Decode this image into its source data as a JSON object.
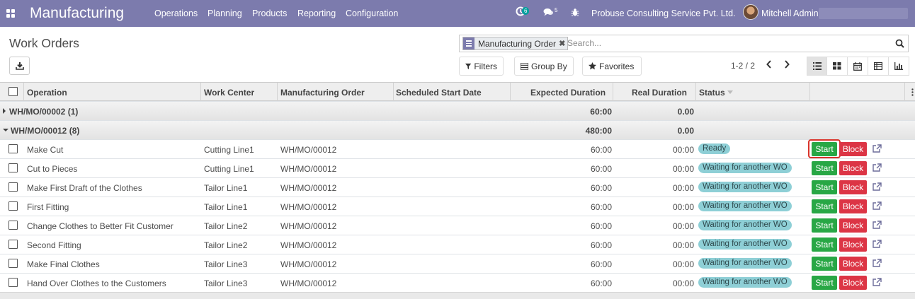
{
  "navbar": {
    "app_name": "Manufacturing",
    "menu": [
      "Operations",
      "Planning",
      "Products",
      "Reporting",
      "Configuration"
    ],
    "activity_count": "6",
    "message_count": "5",
    "company": "Probuse Consulting Service Pvt. Ltd.",
    "user": "Mitchell Admin"
  },
  "control_panel": {
    "title": "Work Orders",
    "facet_value": "Manufacturing Order",
    "search_placeholder": "Search...",
    "filters_label": "Filters",
    "group_by_label": "Group By",
    "favorites_label": "Favorites",
    "pager": "1-2 / 2"
  },
  "table": {
    "headers": {
      "operation": "Operation",
      "work_center": "Work Center",
      "manufacturing_order": "Manufacturing Order",
      "scheduled_start": "Scheduled Start Date",
      "expected_duration": "Expected Duration",
      "real_duration": "Real Duration",
      "status": "Status"
    },
    "groups": [
      {
        "label": "WH/MO/00002 (1)",
        "expected": "60:00",
        "real": "0.00"
      },
      {
        "label": "WH/MO/00012 (8)",
        "expected": "480:00",
        "real": "0.00"
      }
    ],
    "rows": [
      {
        "operation": "Make Cut",
        "work_center": "Cutting Line1",
        "mo": "WH/MO/00012",
        "expected": "60:00",
        "real": "00:00",
        "status": "Ready"
      },
      {
        "operation": "Cut to Pieces",
        "work_center": "Cutting Line1",
        "mo": "WH/MO/00012",
        "expected": "60:00",
        "real": "00:00",
        "status": "Waiting for another WO"
      },
      {
        "operation": "Make First Draft of the Clothes",
        "work_center": "Tailor Line1",
        "mo": "WH/MO/00012",
        "expected": "60:00",
        "real": "00:00",
        "status": "Waiting for another WO"
      },
      {
        "operation": "First Fitting",
        "work_center": "Tailor Line1",
        "mo": "WH/MO/00012",
        "expected": "60:00",
        "real": "00:00",
        "status": "Waiting for another WO"
      },
      {
        "operation": "Change Clothes to Better Fit Customer",
        "work_center": "Tailor Line2",
        "mo": "WH/MO/00012",
        "expected": "60:00",
        "real": "00:00",
        "status": "Waiting for another WO"
      },
      {
        "operation": "Second Fitting",
        "work_center": "Tailor Line2",
        "mo": "WH/MO/00012",
        "expected": "60:00",
        "real": "00:00",
        "status": "Waiting for another WO"
      },
      {
        "operation": "Make Final Clothes",
        "work_center": "Tailor Line3",
        "mo": "WH/MO/00012",
        "expected": "60:00",
        "real": "00:00",
        "status": "Waiting for another WO"
      },
      {
        "operation": "Hand Over Clothes to the Customers",
        "work_center": "Tailor Line3",
        "mo": "WH/MO/00012",
        "expected": "60:00",
        "real": "00:00",
        "status": "Waiting for another WO"
      }
    ],
    "start_label": "Start",
    "block_label": "Block"
  },
  "colors": {
    "navbar": "#7c7bad",
    "start": "#28a745",
    "block": "#dc3545",
    "status_badge": "#8ecfd6",
    "highlight": "#d9342b"
  }
}
